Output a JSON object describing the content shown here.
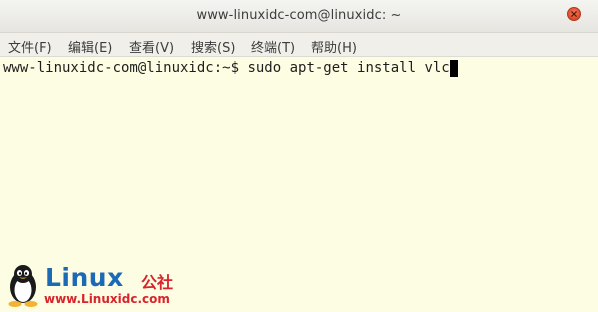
{
  "window": {
    "title": "www-linuxidc-com@linuxidc: ~"
  },
  "menu": {
    "items": [
      {
        "label": "文件(F)"
      },
      {
        "label": "编辑(E)"
      },
      {
        "label": "查看(V)"
      },
      {
        "label": "搜索(S)"
      },
      {
        "label": "终端(T)"
      },
      {
        "label": "帮助(H)"
      }
    ]
  },
  "terminal": {
    "prompt": "www-linuxidc-com@linuxidc:~$ ",
    "command": "sudo apt-get install vlc",
    "background_color": "#fdfde3",
    "text_color": "#1e1e1e"
  },
  "watermark": {
    "brand": "Linux",
    "brand_cn": "公社",
    "url": "www.Linuxidc.com",
    "brand_color": "#1b6ab5",
    "accent_color": "#d8242b"
  },
  "icons": {
    "close": "close-icon",
    "mascot": "penguin-icon"
  }
}
